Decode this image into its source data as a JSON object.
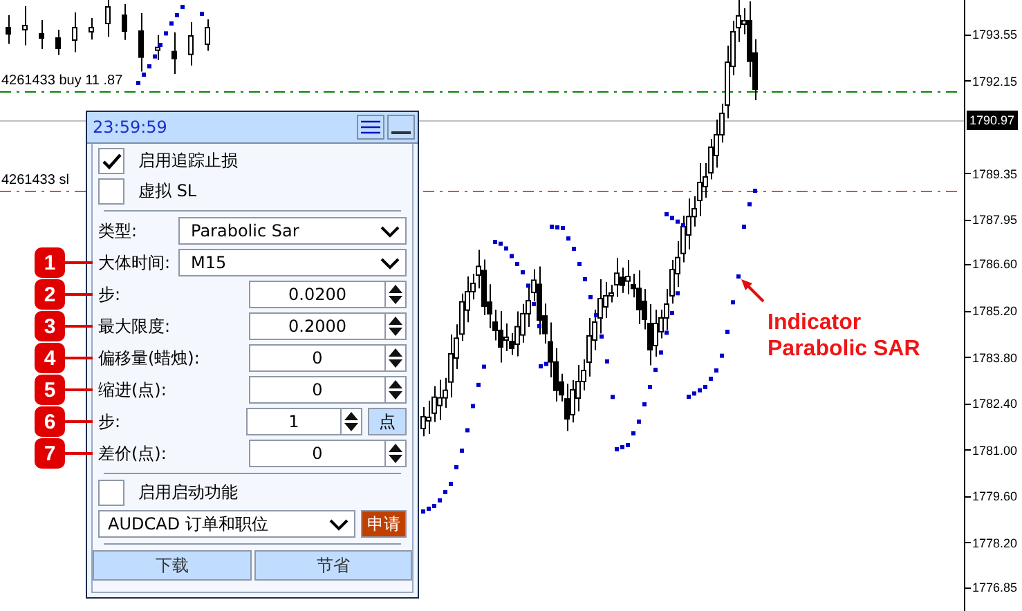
{
  "chart": {
    "price_lines": [
      {
        "kind": "buy",
        "label": "4261433 buy 11 .87"
      },
      {
        "kind": "current"
      },
      {
        "kind": "sl",
        "label": "4261433 sl"
      }
    ],
    "current_price": "1790.97",
    "price_axis": [
      "1793.55",
      "1792.15",
      "1789.35",
      "1787.95",
      "1786.60",
      "1785.20",
      "1783.80",
      "1782.40",
      "1781.00",
      "1779.60",
      "1778.20",
      "1776.85"
    ],
    "annotation": [
      "Indicator",
      "Parabolic SAR"
    ]
  },
  "panel": {
    "time": "23:59:59",
    "rows": [
      {
        "kind": "checkbox",
        "label": "启用追踪止损",
        "checked": true
      },
      {
        "kind": "checkbox",
        "label": "虚拟 SL",
        "checked": false
      },
      {
        "kind": "separator"
      },
      {
        "kind": "select",
        "label": "类型:",
        "value": "Parabolic Sar"
      },
      {
        "kind": "select",
        "label": "大体时间:",
        "value": "M15",
        "callout": "1"
      },
      {
        "kind": "spinner",
        "label": "步:",
        "value": "0.0200",
        "callout": "2"
      },
      {
        "kind": "spinner",
        "label": "最大限度:",
        "value": "0.2000",
        "callout": "3"
      },
      {
        "kind": "spinner",
        "label": "偏移量(蜡烛):",
        "value": "0",
        "callout": "4"
      },
      {
        "kind": "spinner",
        "label": "缩进(点):",
        "value": "0",
        "callout": "5"
      },
      {
        "kind": "spinner",
        "label": "步:",
        "value": "1",
        "unit": "点",
        "callout": "6"
      },
      {
        "kind": "spinner",
        "label": "差价(点):",
        "value": "0",
        "callout": "7"
      },
      {
        "kind": "separator"
      },
      {
        "kind": "checkbox",
        "label": "启用启动功能",
        "checked": false
      },
      {
        "kind": "symbol",
        "value": "AUDCAD 订单和职位",
        "button": "申请"
      },
      {
        "kind": "separator"
      },
      {
        "kind": "buttons",
        "buttons": [
          "下载",
          "节省"
        ]
      }
    ]
  }
}
